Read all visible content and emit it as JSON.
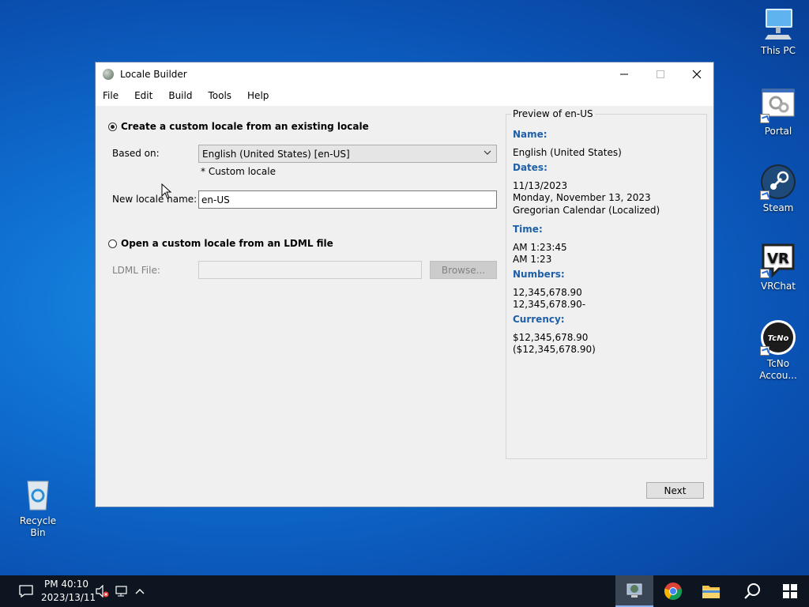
{
  "desktop": {
    "icons": [
      {
        "label": "This PC"
      },
      {
        "label": "Portal"
      },
      {
        "label": "Steam"
      },
      {
        "label": "VRChat"
      },
      {
        "label": "TcNo Accou..."
      },
      {
        "label": "Recycle Bin"
      }
    ]
  },
  "window": {
    "title": "Locale Builder",
    "menu": [
      "File",
      "Edit",
      "Build",
      "Tools",
      "Help"
    ],
    "option_create": "Create a custom locale from an existing locale",
    "based_on_label": "Based on:",
    "based_on_value": "English (United States) [en-US]",
    "custom_locale_note": "* Custom locale",
    "new_locale_label": "New locale name:",
    "new_locale_value": "en-US",
    "option_open": "Open a custom locale from an LDML file",
    "ldml_label": "LDML File:",
    "ldml_value": "",
    "browse_label": "Browse...",
    "next_label": "Next",
    "preview": {
      "title": "Preview of en-US",
      "name_header": "Name:",
      "name_value": "English (United States)",
      "dates_header": "Dates:",
      "dates_short": "11/13/2023",
      "dates_long": "Monday, November 13, 2023",
      "dates_calendar": "Gregorian Calendar (Localized)",
      "time_header": "Time:",
      "time_long": "AM 1:23:45",
      "time_short": "AM 1:23",
      "numbers_header": "Numbers:",
      "numbers_pos": "12,345,678.90",
      "numbers_neg": "12,345,678.90-",
      "currency_header": "Currency:",
      "currency_pos": "$12,345,678.90",
      "currency_neg": "($12,345,678.90)"
    }
  },
  "taskbar": {
    "clock_time": "PM 40:10",
    "clock_date": "2023/13/11"
  }
}
